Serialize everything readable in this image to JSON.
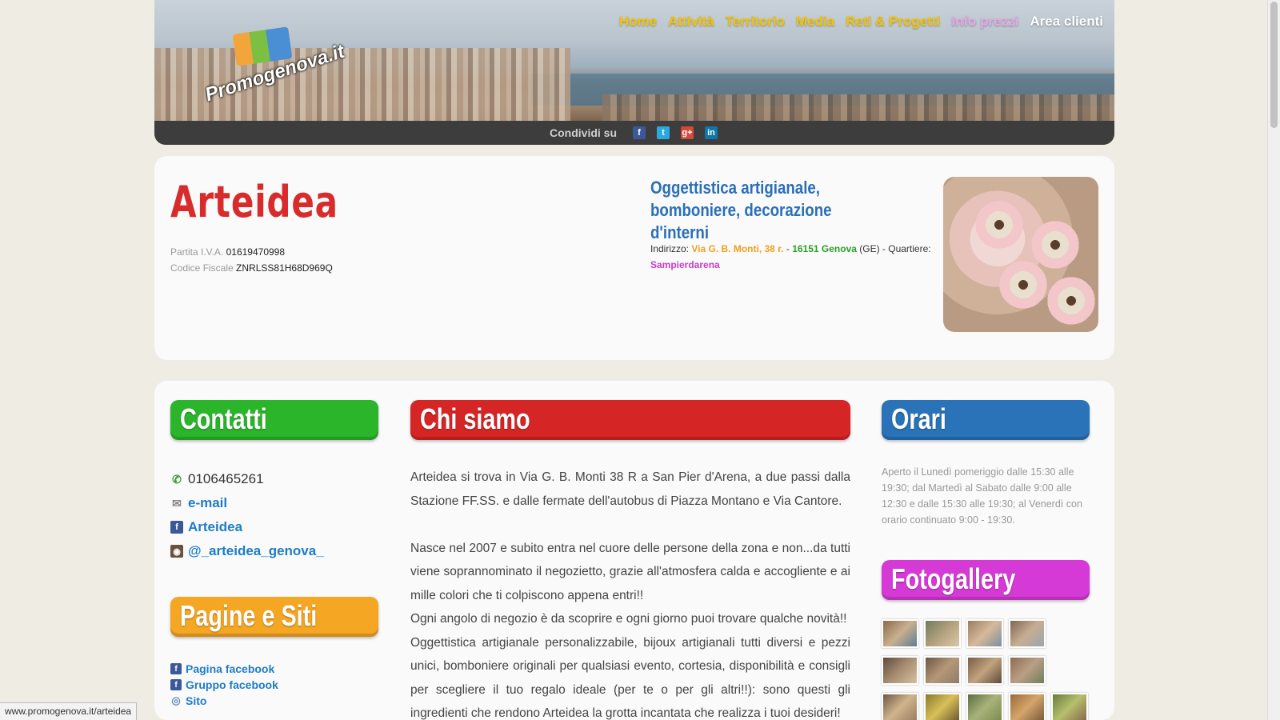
{
  "nav": {
    "items": [
      {
        "label": "Home",
        "color": "#f5c400"
      },
      {
        "label": "Attività",
        "color": "#f5c400"
      },
      {
        "label": "Territorio",
        "color": "#f5c400"
      },
      {
        "label": "Media",
        "color": "#f5c400"
      },
      {
        "label": "Reti & Progetti",
        "color": "#f5c400"
      },
      {
        "label": "Info prezzi",
        "color": "#e7a6e6"
      },
      {
        "label": "Area clienti",
        "color": "#ffffff"
      }
    ]
  },
  "logo": {
    "text": "Promogenova.it"
  },
  "share": {
    "label": "Condividi su",
    "icons": [
      {
        "name": "facebook-icon",
        "glyph": "f",
        "color": "#3b5998"
      },
      {
        "name": "twitter-icon",
        "glyph": "t",
        "color": "#2aa9e0"
      },
      {
        "name": "google-plus-icon",
        "glyph": "g+",
        "color": "#d34836"
      },
      {
        "name": "linkedin-icon",
        "glyph": "in",
        "color": "#0e76a8"
      }
    ]
  },
  "profile": {
    "name": "Arteidea",
    "vat_label": "Partita I.V.A.",
    "vat_value": "01619470998",
    "fiscal_label": "Codice Fiscale",
    "fiscal_value": "ZNRLSS81H68D969Q",
    "tagline": "Oggettistica artigianale, bomboniere, decorazione d'interni",
    "address_label": "Indirizzo:",
    "address_street": "Via G. B. Monti, 38 r.",
    "address_sep": " - ",
    "address_cap": "16151 Genova",
    "address_prov": " (GE) - Quartiere:",
    "address_quarter": "Sampierdarena"
  },
  "sections": {
    "contacts": {
      "title": "Contatti",
      "color": "#2bb52b"
    },
    "about": {
      "title": "Chi siamo",
      "color": "#d62525"
    },
    "hours": {
      "title": "Orari",
      "color": "#2a73b8"
    },
    "pages": {
      "title": "Pagine e Siti",
      "color": "#f5a623"
    },
    "gallery": {
      "title": "Fotogallery",
      "color": "#d63ad6"
    }
  },
  "contacts": {
    "phone": "0106465261",
    "email_label": "e-mail",
    "facebook_label": "Arteidea",
    "instagram_label": "@_arteidea_genova_"
  },
  "pages_links": {
    "facebook_page": "Pagina facebook",
    "facebook_group": "Gruppo facebook",
    "site": "Sito"
  },
  "about": {
    "p1": "Arteidea si trova in Via G. B. Monti 38 R a San Pier d'Arena, a due passi dalla Stazione FF.SS. e dalle fermate dell'autobus di Piazza Montano e Via Cantore.",
    "p2": "Nasce nel 2007 e subito entra nel cuore delle persone della zona e non...da tutti viene soprannominato il negozietto, grazie all'atmosfera calda e accogliente e ai mille colori che ti colpiscono appena entri!!",
    "p3": "Ogni angolo di negozio è da scoprire e ogni giorno puoi trovare qualche novità!!",
    "p4": "Oggettistica artigianale personalizzabile, bijoux artigianali tutti diversi e pezzi unici, bomboniere originali per qualsiasi evento, cortesia, disponibilità e consigli per scegliere il tuo regalo ideale (per te o per gli altri!!): sono questi gli ingredienti che rendono Arteidea la grotta incantata che realizza i tuoi desideri!"
  },
  "hours": {
    "text": "Aperto il Lunedì pomeriggio dalle 15:30 alle 19:30; dal Martedì al Sabato dalle 9:00 alle 12:30 e dalle 15:30 alle 19:30; al Venerdì con orario continuato 9:00 - 19:30."
  },
  "status_bar": {
    "url": "www.promogenova.it/arteidea"
  }
}
